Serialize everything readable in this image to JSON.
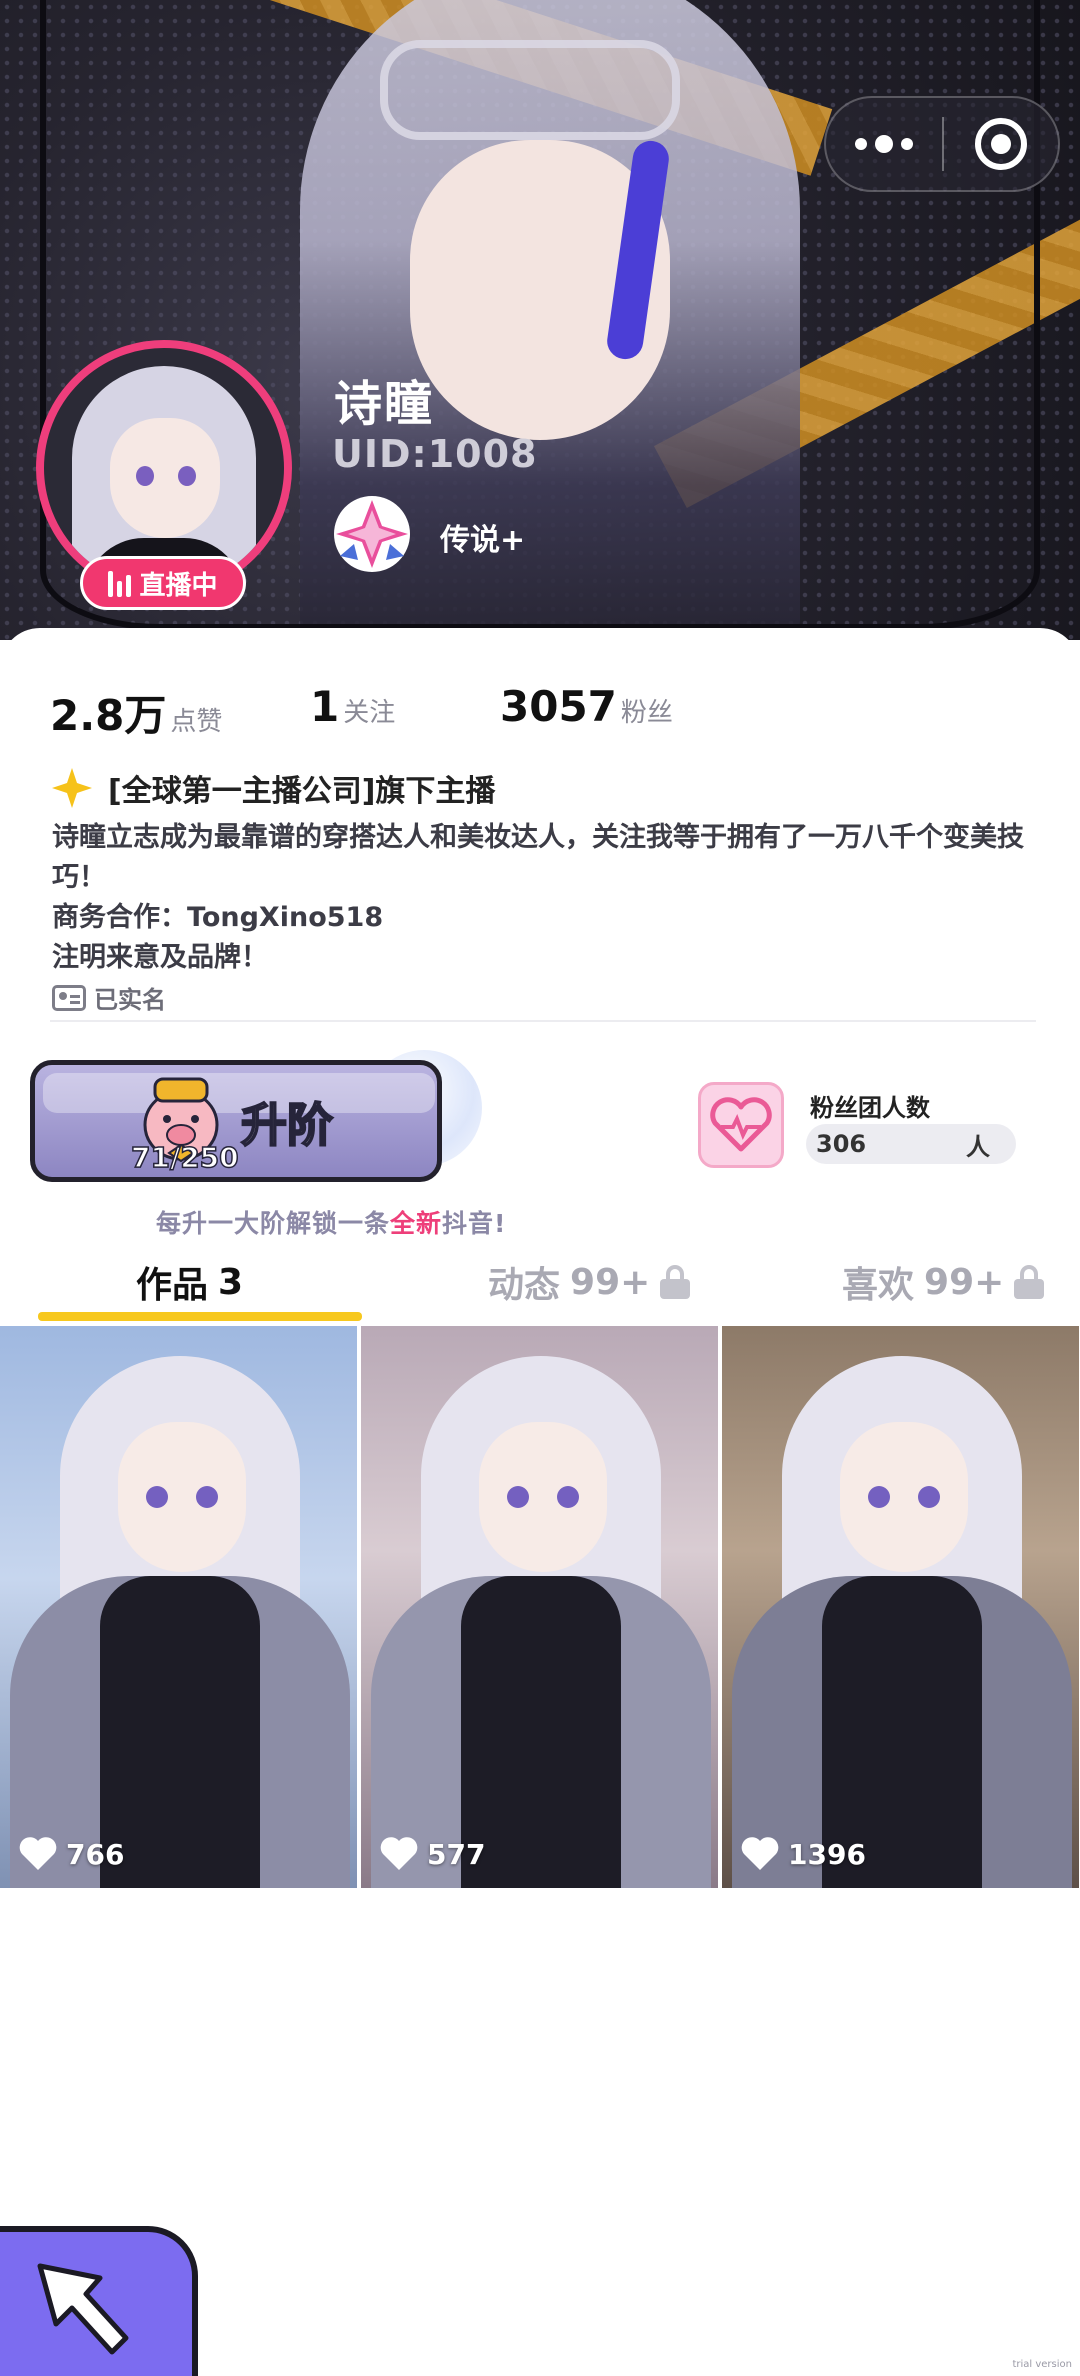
{
  "header": {
    "nickname": "诗瞳",
    "uid": "UID:1008",
    "rank": "传说+",
    "live_badge": "直播中",
    "menu_icon": "more-dots-icon",
    "close_icon": "target-close-icon"
  },
  "stats": [
    {
      "value": "2.8万",
      "label": "点赞"
    },
    {
      "value": "1",
      "label": "关注"
    },
    {
      "value": "3057",
      "label": "粉丝"
    }
  ],
  "profile": {
    "tagline": "[全球第一主播公司]旗下主播",
    "bio": "诗瞳立志成为最靠谱的穿搭达人和美妆达人，关注我等于拥有了一万八千个变美技巧！\n商务合作：TongXino518\n注明来意及品牌！",
    "verified": "已实名"
  },
  "upgrade": {
    "label": "升阶",
    "progress": "71/250"
  },
  "fan_club": {
    "title": "粉丝团人数",
    "count": "306",
    "unit": "人"
  },
  "unlock_tip": {
    "before": "每升一大阶解锁一条",
    "highlight": "全新",
    "after": "抖音!"
  },
  "tabs": [
    {
      "label": "作品",
      "count": "3",
      "locked": false
    },
    {
      "label": "动态",
      "count": "99+",
      "locked": true
    },
    {
      "label": "喜欢",
      "count": "99+",
      "locked": true
    }
  ],
  "videos": [
    {
      "likes": "766"
    },
    {
      "likes": "577"
    },
    {
      "likes": "1396"
    }
  ],
  "watermark": "trial version",
  "colors": {
    "accent_pink": "#ef3e7c",
    "tab_underline": "#f7c81e",
    "upgrade_purple": "#8d86c2",
    "fab_purple": "#7c6cf0"
  }
}
